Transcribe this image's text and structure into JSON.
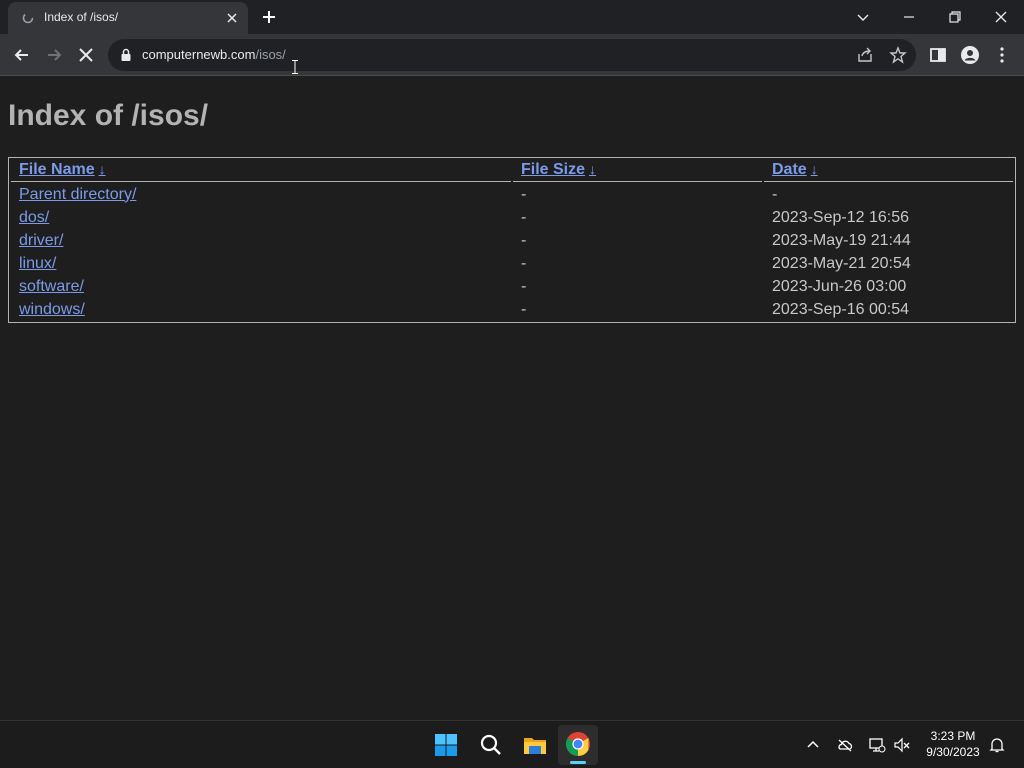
{
  "browser": {
    "tab_title": "Index of /isos/",
    "url_host": "computernewb.com",
    "url_path": "/isos/"
  },
  "page": {
    "heading": "Index of /isos/",
    "columns": [
      "File Name",
      "File Size",
      "Date"
    ],
    "sort_arrow": "↓",
    "rows": [
      {
        "name": "Parent directory/",
        "size": "-",
        "date": "-"
      },
      {
        "name": "dos/",
        "size": "-",
        "date": "2023-Sep-12 16:56"
      },
      {
        "name": "driver/",
        "size": "-",
        "date": "2023-May-19 21:44"
      },
      {
        "name": "linux/",
        "size": "-",
        "date": "2023-May-21 20:54"
      },
      {
        "name": "software/",
        "size": "-",
        "date": "2023-Jun-26 03:00"
      },
      {
        "name": "windows/",
        "size": "-",
        "date": "2023-Sep-16 00:54"
      }
    ]
  },
  "taskbar": {
    "time": "3:23 PM",
    "date": "9/30/2023"
  },
  "colors": {
    "link": "#7b9be8",
    "background": "#1e1e1e",
    "accent": "#60cdff"
  }
}
